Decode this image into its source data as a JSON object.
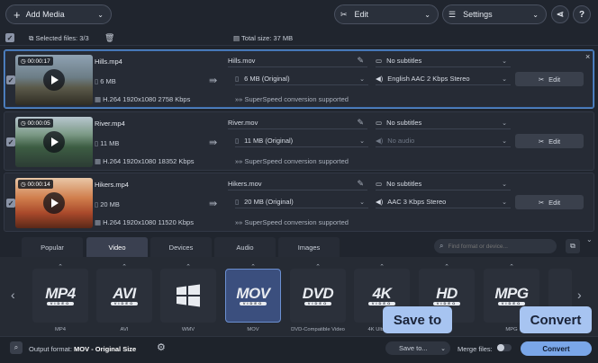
{
  "toolbar": {
    "add_media": "Add Media",
    "edit": "Edit",
    "settings": "Settings",
    "share_icon": "share-icon",
    "help": "?"
  },
  "selection": {
    "selected_files": "Selected files: 3/3",
    "total_size": "Total size: 37 MB"
  },
  "files": [
    {
      "duration": "00:00:17",
      "name": "Hills.mp4",
      "size": "6 MB",
      "codec": "H.264 1920x1080 2758 Kbps",
      "out_name": "Hills.mov",
      "out_size": "6 MB (Original)",
      "superspeed": "SuperSpeed conversion supported",
      "subtitles": "No subtitles",
      "audio": "English AAC 2 Kbps Stereo",
      "edit": "Edit"
    },
    {
      "duration": "00:00:05",
      "name": "River.mp4",
      "size": "11 MB",
      "codec": "H.264 1920x1080 18352 Kbps",
      "out_name": "River.mov",
      "out_size": "11 MB (Original)",
      "superspeed": "SuperSpeed conversion supported",
      "subtitles": "No subtitles",
      "audio": "No audio",
      "edit": "Edit"
    },
    {
      "duration": "00:00:14",
      "name": "Hikers.mp4",
      "size": "20 MB",
      "codec": "H.264 1920x1080 11520 Kbps",
      "out_name": "Hikers.mov",
      "out_size": "20 MB (Original)",
      "superspeed": "SuperSpeed conversion supported",
      "subtitles": "No subtitles",
      "audio": "AAC 3 Kbps Stereo",
      "edit": "Edit"
    }
  ],
  "tabs": [
    "Popular",
    "Video",
    "Devices",
    "Audio",
    "Images"
  ],
  "search": {
    "placeholder": "Find format or device..."
  },
  "formats": [
    {
      "logo": "MP4",
      "label": "MP4"
    },
    {
      "logo": "AVI",
      "label": "AVI"
    },
    {
      "logo": "WMV",
      "label": "WMV"
    },
    {
      "logo": "MOV",
      "label": "MOV"
    },
    {
      "logo": "DVD",
      "label": "DVD-Compatible Video"
    },
    {
      "logo": "4K",
      "label": "4K Ultra HD"
    },
    {
      "logo": "HD",
      "label": "HD"
    },
    {
      "logo": "MPG",
      "label": "MPG"
    }
  ],
  "footer": {
    "output_label": "Output format:",
    "output_value": "MOV - Original Size",
    "save_to": "Save to...",
    "merge": "Merge files:",
    "convert": "Convert"
  },
  "callouts": {
    "save_to": "Save to",
    "convert": "Convert"
  },
  "colors": {
    "accent": "#5a8fd0",
    "convert": "#a7c4f1",
    "bg": "#20252e"
  }
}
